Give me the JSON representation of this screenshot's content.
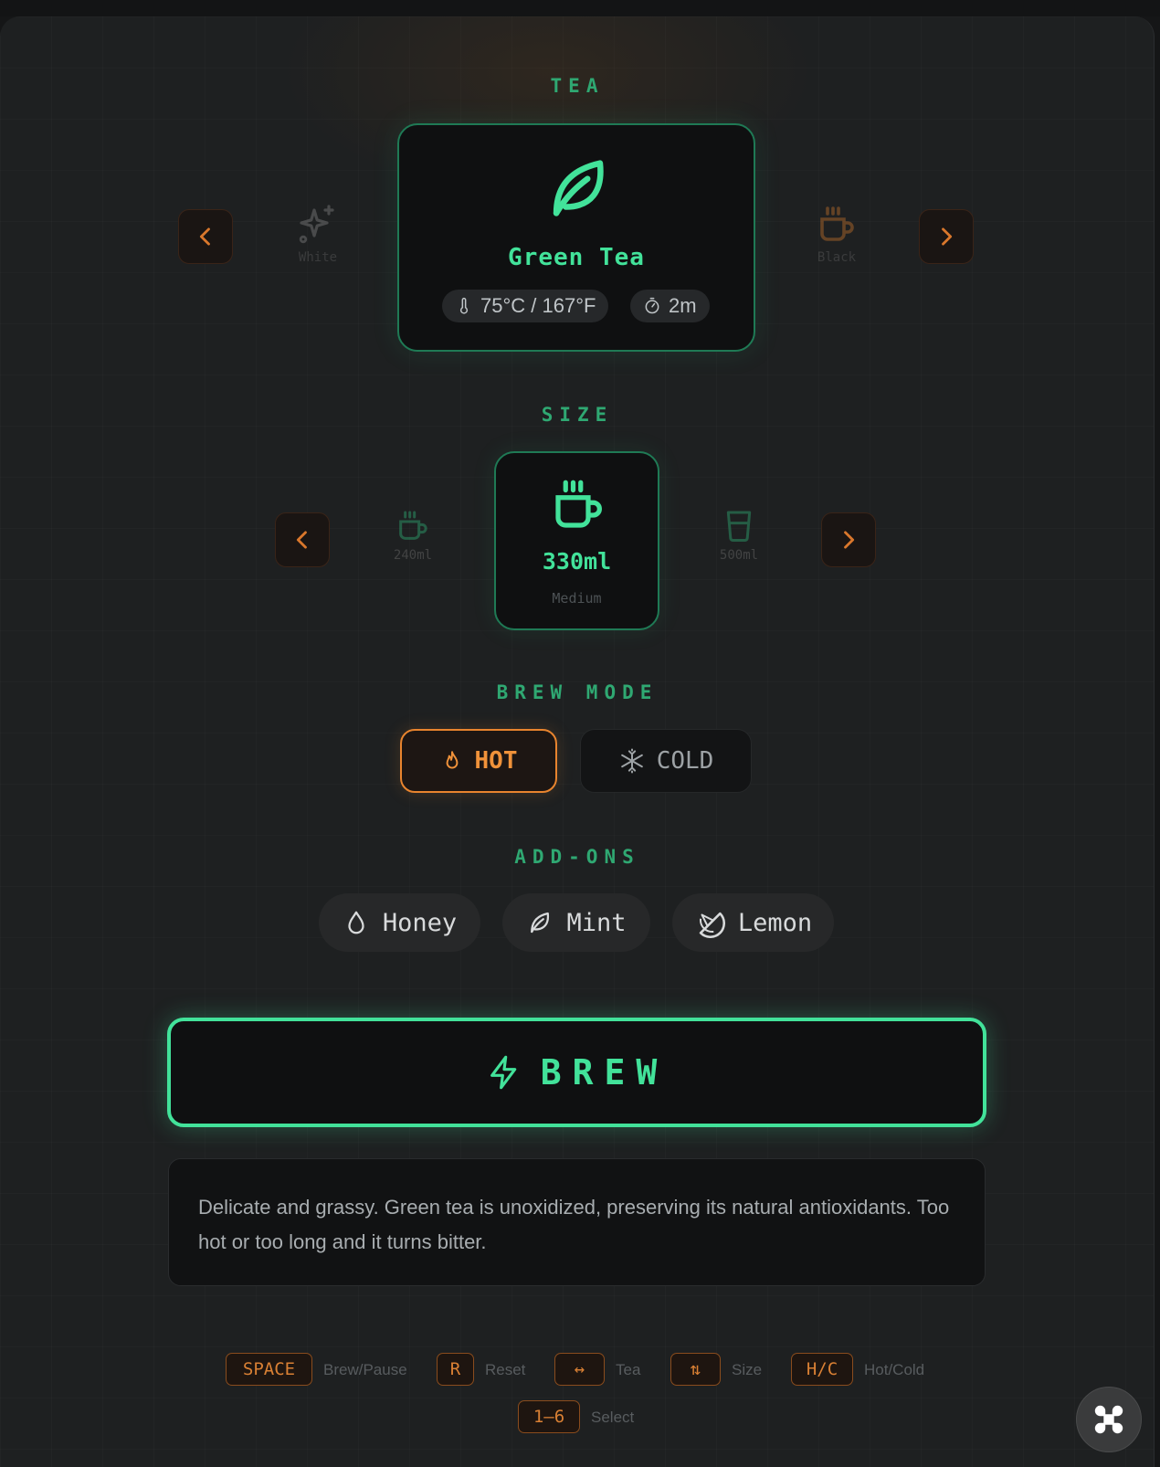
{
  "sections": {
    "tea": "TEA",
    "size": "SIZE",
    "brew_mode": "BREW MODE",
    "addons": "ADD-ONS"
  },
  "tea": {
    "prev_label": "White",
    "next_label": "Black",
    "selected": {
      "name": "Green Tea",
      "temperature": "75°C / 167°F",
      "time": "2m",
      "icon": "leaf-icon"
    }
  },
  "size": {
    "prev_label": "240ml",
    "next_label": "500ml",
    "selected": {
      "value": "330ml",
      "label": "Medium",
      "icon": "mug-icon"
    }
  },
  "brew_mode": {
    "hot": "HOT",
    "cold": "COLD",
    "selected": "HOT"
  },
  "addons": [
    {
      "label": "Honey",
      "icon": "drop-icon"
    },
    {
      "label": "Mint",
      "icon": "leaf-icon"
    },
    {
      "label": "Lemon",
      "icon": "citrus-icon"
    }
  ],
  "brew_button": "BREW",
  "description": "Delicate and grassy. Green tea is unoxidized, preserving its natural antioxidants. Too hot or too long and it turns bitter.",
  "shortcuts": [
    {
      "key": "SPACE",
      "label": "Brew/Pause"
    },
    {
      "key": "R",
      "label": "Reset"
    },
    {
      "key": "↔",
      "label": "Tea"
    },
    {
      "key": "⇅",
      "label": "Size"
    },
    {
      "key": "H/C",
      "label": "Hot/Cold"
    },
    {
      "key": "1–6",
      "label": "Select"
    }
  ],
  "colors": {
    "accent_green": "#42e29a",
    "accent_orange": "#e8842e",
    "background": "#1e2021"
  }
}
